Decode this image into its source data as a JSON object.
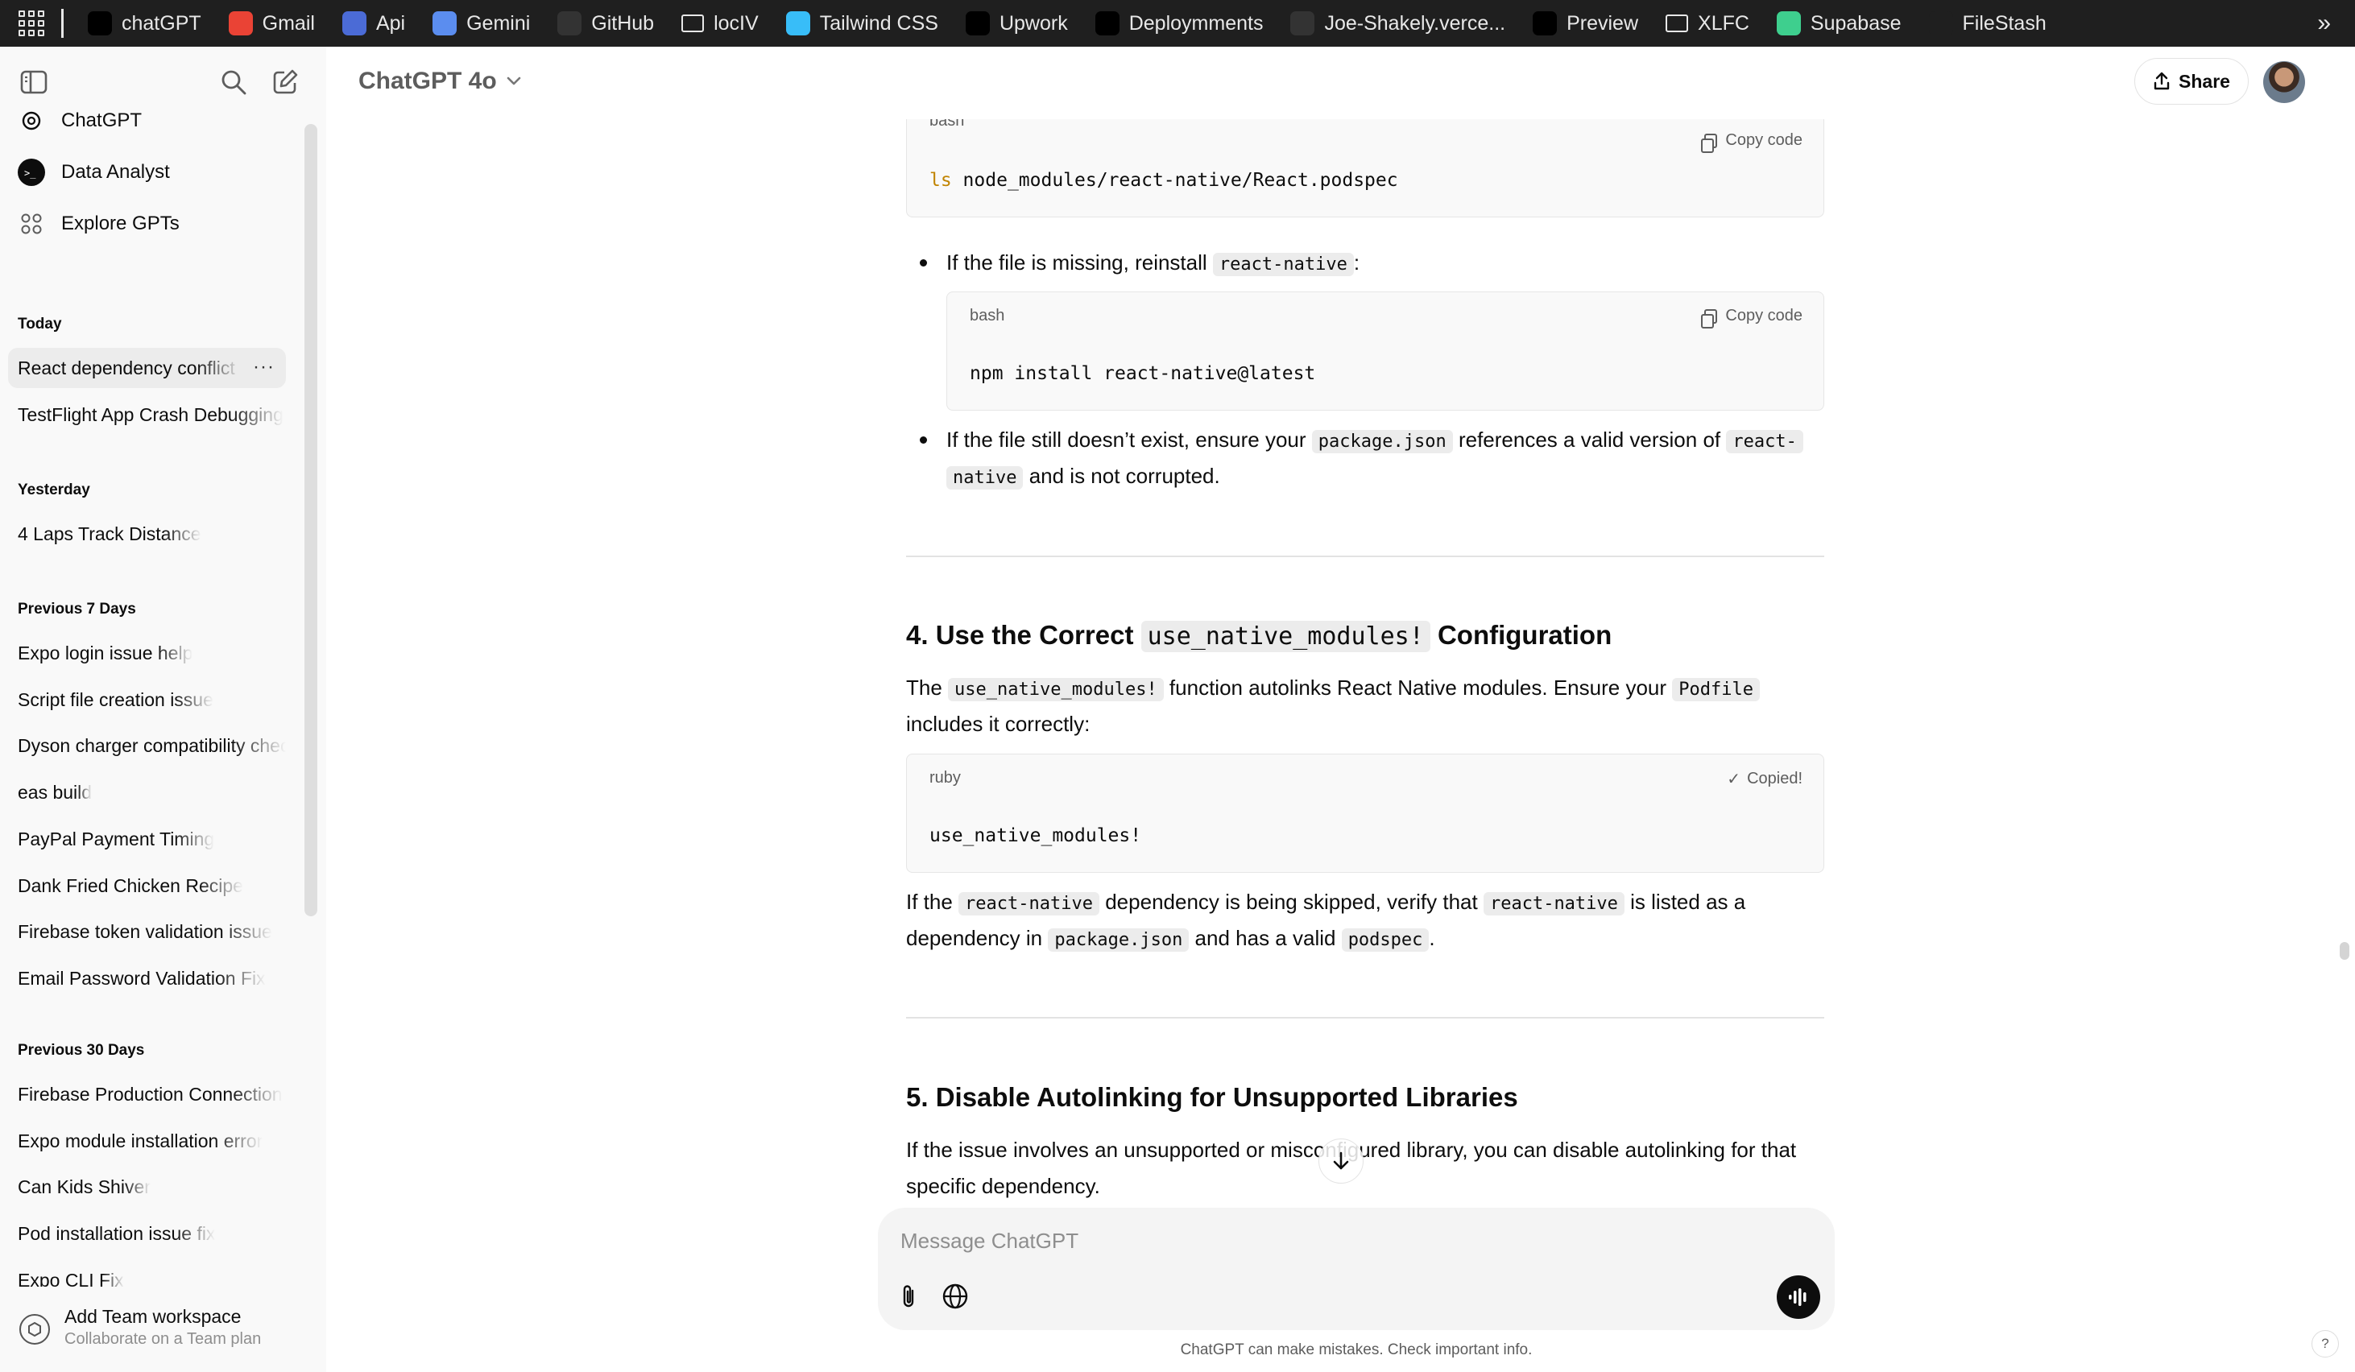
{
  "bookmarks": [
    {
      "label": "chatGPT",
      "icon": "chatgpt-icon",
      "color": "#000000"
    },
    {
      "label": "Gmail",
      "icon": "gmail-icon",
      "color": "#ea4335"
    },
    {
      "label": "Api",
      "icon": "api-icon",
      "color": "#4b6bd6"
    },
    {
      "label": "Gemini",
      "icon": "gemini-icon",
      "color": "#5b8def"
    },
    {
      "label": "GitHub",
      "icon": "github-icon",
      "color": "#333333"
    },
    {
      "label": "locIV",
      "icon": "folder-icon",
      "color": "#1f1f1f"
    },
    {
      "label": "Tailwind CSS",
      "icon": "tailwind-icon",
      "color": "#38bdf8"
    },
    {
      "label": "Upwork",
      "icon": "upwork-icon",
      "color": "#000000"
    },
    {
      "label": "Deploymments",
      "icon": "vercel-icon",
      "color": "#000000"
    },
    {
      "label": "Joe-Shakely.verce...",
      "icon": "site-icon",
      "color": "#333333"
    },
    {
      "label": "Preview",
      "icon": "vercel-icon",
      "color": "#000000"
    },
    {
      "label": "XLFC",
      "icon": "folder-icon",
      "color": "#1f1f1f"
    },
    {
      "label": "Supabase",
      "icon": "supabase-icon",
      "color": "#3ecf8e"
    },
    {
      "label": "FileStash",
      "icon": "filestash-icon",
      "color": "#1f1f1f"
    }
  ],
  "sidebar": {
    "gpts": [
      {
        "label": "ChatGPT",
        "icon": "chatgpt-logo-icon"
      },
      {
        "label": "Data Analyst",
        "icon": "data-analyst-icon"
      },
      {
        "label": "Explore GPTs",
        "icon": "grid-icon"
      }
    ],
    "sections": {
      "today": "Today",
      "yesterday": "Yesterday",
      "prev7": "Previous 7 Days",
      "prev30": "Previous 30 Days"
    },
    "today": [
      "React dependency conflict",
      "TestFlight App Crash Debugging"
    ],
    "yesterday": [
      "4 Laps Track Distance"
    ],
    "prev7": [
      "Expo login issue help",
      "Script file creation issue",
      "Dyson charger compatibility check",
      "eas build",
      "PayPal Payment Timing",
      "Dank Fried Chicken Recipe",
      "Firebase token validation issue",
      "Email Password Validation Fix"
    ],
    "prev30": [
      "Firebase Production Connection",
      "Expo module installation error",
      "Can Kids Shiver",
      "Pod installation issue fix",
      "Expo CLI Fix"
    ],
    "more_dots": "···",
    "team": {
      "title": "Add Team workspace",
      "subtitle": "Collaborate on a Team plan"
    }
  },
  "header": {
    "model": "ChatGPT 4o",
    "share": "Share"
  },
  "content": {
    "block1": {
      "lang": "bash",
      "copy": "Copy code",
      "cmd_kw": "ls",
      "cmd_rest": " node_modules/react-native/React.podspec"
    },
    "bullet1": {
      "pre": "If the file is missing, reinstall ",
      "code": "react-native",
      "post": ":"
    },
    "block2": {
      "lang": "bash",
      "copy": "Copy code",
      "code": "npm install react-native@latest"
    },
    "bullet2": {
      "pre": "If the file still doesn’t exist, ensure your ",
      "code1": "package.json",
      "mid": " references a valid version of ",
      "code2a": "react-",
      "code2b": "native",
      "post": " and is not corrupted."
    },
    "h4": {
      "pre": "4. Use the Correct ",
      "code": "use_native_modules!",
      "post": " Configuration"
    },
    "p4": {
      "t1": "The ",
      "c1": "use_native_modules!",
      "t2": " function autolinks React Native modules. Ensure your ",
      "c2": "Podfile",
      "t3": "includes it correctly:"
    },
    "block3": {
      "lang": "ruby",
      "copied": "Copied!",
      "code": "use_native_modules!"
    },
    "p5": {
      "t1": "If the ",
      "c1": "react-native",
      "t2": " dependency is being skipped, verify that ",
      "c2": "react-native",
      "t3": " is listed as a",
      "t4": "dependency in ",
      "c3": "package.json",
      "t5": " and has a valid ",
      "c4": "podspec",
      "t6": "."
    },
    "h5": "5. Disable Autolinking for Unsupported Libraries",
    "p6": {
      "line1": "If the issue involves an unsupported or misconfigured library, you can disable autolinking for that",
      "line2": "specific dependency."
    }
  },
  "composer": {
    "placeholder": "Message ChatGPT"
  },
  "disclaimer": "ChatGPT can make mistakes. Check important info.",
  "help": "?"
}
